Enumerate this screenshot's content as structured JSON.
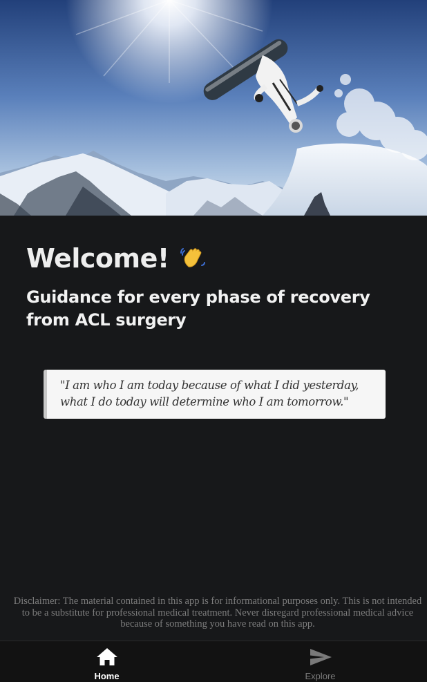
{
  "hero": {
    "image": "snowboarder-mountain-photo"
  },
  "welcome": {
    "title": "Welcome!",
    "emoji": "waving-hand"
  },
  "subtitle": "Guidance for every phase of recovery from ACL surgery",
  "quote": "\"I am who I am today because of what I did yesterday, what I do today will determine who I am tomorrow.\"",
  "disclaimer": {
    "lines": [
      "Disclaimer: The material contained in this app is for informational purposes only. This is not intended",
      "to be a substitute for professional medical treatment. Never disregard professional medical advice",
      "because of something you have read on this app."
    ]
  },
  "tabs": [
    {
      "label": "Home",
      "icon": "home-icon",
      "active": true
    },
    {
      "label": "Explore",
      "icon": "send-icon",
      "active": false
    }
  ],
  "colors": {
    "background": "#17181a",
    "quote_bg": "#f6f6f6",
    "tab_active": "#ffffff",
    "tab_inactive": "#7a7a7a"
  }
}
